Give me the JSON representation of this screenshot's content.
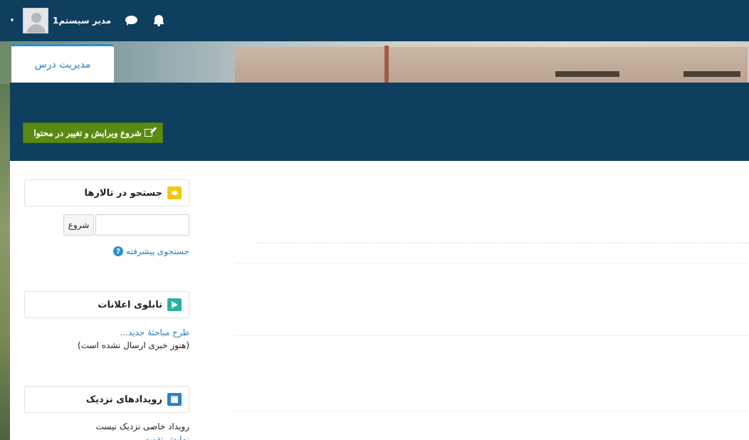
{
  "navbar": {
    "username": "مدیر سیستم1",
    "user_menu_caret": "▾",
    "icons": [
      "chat-icon",
      "bell-icon",
      "avatar"
    ]
  },
  "tab": {
    "label": "مدیریت درس"
  },
  "header": {
    "edit_button_label": "شروع ویرایش و تغییر در محتوا"
  },
  "blocks": {
    "search_forums": {
      "title": "جستجو در تالارها",
      "search_value": "",
      "search_button": "شروع",
      "advanced_search": "جستجوی پیشرفته",
      "help_glyph": "?"
    },
    "news": {
      "title": "تابلوی اعلانات",
      "new_topic": "طرح مباحثهٔ جدید...",
      "empty": "(هنوز خبری ارسال نشده است)"
    },
    "events": {
      "title": "رویدادهای نزدیک",
      "empty": "رویداد خاصی نزدیک نیست",
      "go_to_calendar": "نمایش تقویم..."
    }
  },
  "colors": {
    "navbar": "#0f3f5f",
    "accent_blue": "#2a7fc1",
    "edit_button": "#5a8a12",
    "badge_yellow": "#f3c811",
    "badge_green": "#2bb29b",
    "badge_blue": "#2980c5"
  }
}
